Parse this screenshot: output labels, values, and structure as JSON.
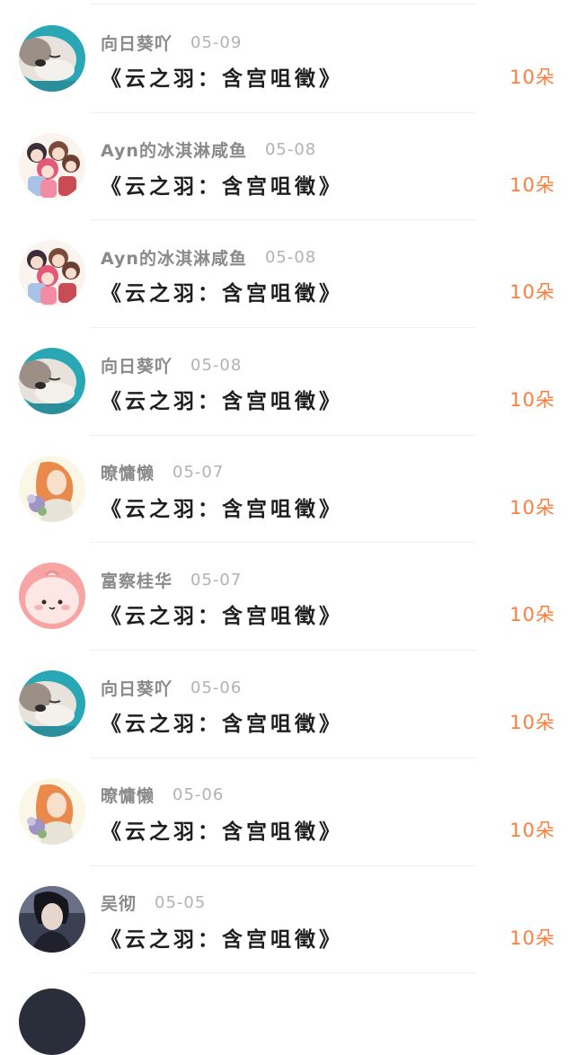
{
  "records": [
    {
      "username": "向日葵吖",
      "date": "05-09",
      "title": "《云之羽：含宫咀徵》",
      "amount": "10朵",
      "avatar": "dog-avatar-icon"
    },
    {
      "username": "Ayn的冰淇淋咸鱼",
      "date": "05-08",
      "title": "《云之羽：含宫咀徵》",
      "amount": "10朵",
      "avatar": "anime-girls-avatar-icon"
    },
    {
      "username": "Ayn的冰淇淋咸鱼",
      "date": "05-08",
      "title": "《云之羽：含宫咀徵》",
      "amount": "10朵",
      "avatar": "anime-girls-avatar-icon"
    },
    {
      "username": "向日葵吖",
      "date": "05-08",
      "title": "《云之羽：含宫咀徵》",
      "amount": "10朵",
      "avatar": "dog-avatar-icon"
    },
    {
      "username": "暸慵懒",
      "date": "05-07",
      "title": "《云之羽：含宫咀徵》",
      "amount": "10朵",
      "avatar": "flower-girl-avatar-icon"
    },
    {
      "username": "富察桂华",
      "date": "05-07",
      "title": "《云之羽：含宫咀徵》",
      "amount": "10朵",
      "avatar": "pink-blob-avatar-icon"
    },
    {
      "username": "向日葵吖",
      "date": "05-06",
      "title": "《云之羽：含宫咀徵》",
      "amount": "10朵",
      "avatar": "dog-avatar-icon"
    },
    {
      "username": "暸慵懒",
      "date": "05-06",
      "title": "《云之羽：含宫咀徵》",
      "amount": "10朵",
      "avatar": "flower-girl-avatar-icon"
    },
    {
      "username": "吴彻",
      "date": "05-05",
      "title": "《云之羽：含宫咀徵》",
      "amount": "10朵",
      "avatar": "portrait-avatar-icon"
    }
  ],
  "colors": {
    "amount": "#ff7d3a",
    "username": "#8a8a8a",
    "date": "#b2b2b2",
    "title": "#1e1e1e",
    "divider": "#f0f0f0"
  }
}
